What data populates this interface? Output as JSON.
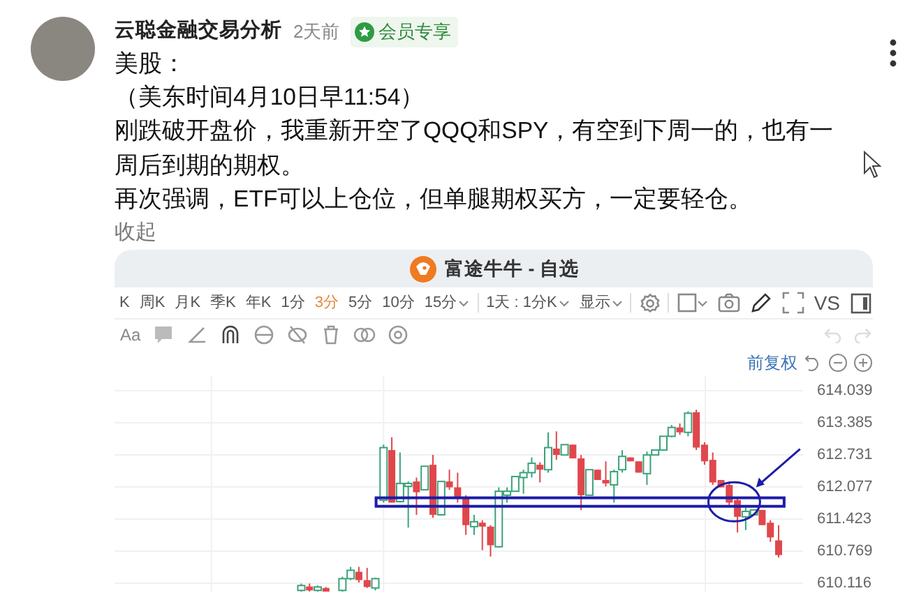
{
  "post": {
    "author": "云聪金融交易分析",
    "time": "2天前",
    "badge": "会员专享",
    "paragraphs": [
      "美股：",
      "（美东时间4月10日早11:54）",
      "刚跌破开盘价，我重新开空了QQQ和SPY，有空到下周一的，也有一周后到期的期权。",
      "再次强调，ETF可以上仓位，但单腿期权买方，一定要轻仓。"
    ],
    "collapse_link": "收起"
  },
  "embedded_window": {
    "title": "富途牛牛 - 自选",
    "toolbar_items": [
      {
        "label": "K",
        "kind": "tab",
        "selected": false
      },
      {
        "label": "周K",
        "kind": "tab",
        "selected": false
      },
      {
        "label": "月K",
        "kind": "tab",
        "selected": false
      },
      {
        "label": "季K",
        "kind": "tab",
        "selected": false
      },
      {
        "label": "年K",
        "kind": "tab",
        "selected": false
      },
      {
        "label": "1分",
        "kind": "tab",
        "selected": false
      },
      {
        "label": "3分",
        "kind": "tab",
        "selected": true
      },
      {
        "label": "5分",
        "kind": "tab",
        "selected": false
      },
      {
        "label": "10分",
        "kind": "tab",
        "selected": false
      },
      {
        "label": "15分",
        "kind": "dropdown",
        "selected": false
      },
      {
        "label": "1天 : 1分K",
        "kind": "dropdown",
        "selected": false
      },
      {
        "label": "显示",
        "kind": "dropdown",
        "selected": false
      }
    ],
    "compare_label": "VS",
    "font_tool_label": "Aa",
    "adjustment_link": "前复权",
    "chart_data": {
      "type": "candlestick",
      "grid": true,
      "ylim": [
        609.946,
        614.352
      ],
      "yticks": [
        {
          "value": 614.039,
          "label": "614.039"
        },
        {
          "value": 613.385,
          "label": "613.385"
        },
        {
          "value": 612.731,
          "label": "612.731"
        },
        {
          "value": 612.077,
          "label": "612.077"
        },
        {
          "value": 611.423,
          "label": "611.423"
        },
        {
          "value": 610.769,
          "label": "610.769"
        },
        {
          "value": 610.116,
          "label": "610.116"
        }
      ],
      "categories": [
        null,
        null,
        null,
        null,
        null,
        null,
        null,
        null,
        null,
        null,
        null,
        null,
        null,
        null,
        null,
        null,
        null,
        null,
        null,
        null,
        null,
        null,
        null,
        null,
        null,
        null,
        null,
        null,
        null,
        null,
        null,
        null,
        null,
        null,
        null,
        null,
        null,
        null,
        null,
        null,
        null,
        null,
        null,
        null,
        null,
        null,
        null,
        null,
        null,
        null,
        null,
        null,
        null,
        null,
        null,
        null,
        null,
        null,
        null
      ],
      "ohlc": [
        [
          609.97,
          610.11,
          609.94,
          610.07
        ],
        [
          610.05,
          610.11,
          609.94,
          609.97
        ],
        [
          609.97,
          610.07,
          609.94,
          610.04
        ],
        [
          610.02,
          610.04,
          609.92,
          609.94
        ],
        null,
        [
          609.97,
          610.25,
          609.94,
          610.21
        ],
        [
          610.21,
          610.45,
          610.18,
          610.38
        ],
        [
          610.35,
          610.45,
          610.13,
          610.18
        ],
        [
          610.18,
          610.43,
          610.02,
          610.04
        ],
        [
          610.02,
          610.23,
          609.97,
          610.21
        ],
        [
          611.81,
          612.94,
          611.76,
          612.88
        ],
        [
          612.83,
          613.09,
          611.76,
          611.76
        ],
        [
          611.78,
          612.78,
          611.76,
          612.15
        ],
        [
          612.09,
          612.19,
          611.25,
          612.15
        ],
        [
          612.19,
          612.27,
          611.51,
          611.97
        ],
        [
          612.02,
          612.5,
          612.02,
          612.5
        ],
        [
          612.53,
          612.73,
          611.45,
          611.51
        ],
        [
          611.51,
          612.19,
          611.51,
          612.19
        ],
        [
          612.19,
          612.43,
          612.02,
          612.07
        ],
        [
          612.07,
          612.37,
          611.76,
          611.86
        ],
        [
          611.86,
          611.91,
          611.1,
          611.3
        ],
        [
          611.27,
          611.51,
          611.1,
          611.37
        ],
        [
          611.35,
          611.4,
          610.79,
          611.27
        ],
        [
          611.27,
          611.3,
          610.66,
          610.89
        ],
        [
          610.86,
          612.07,
          610.84,
          611.99
        ],
        [
          611.91,
          612.07,
          611.76,
          611.99
        ],
        [
          611.99,
          612.29,
          611.99,
          612.29
        ],
        [
          612.27,
          612.43,
          611.94,
          612.37
        ],
        [
          612.37,
          612.68,
          612.27,
          612.56
        ],
        [
          612.53,
          612.58,
          612.17,
          612.43
        ],
        [
          612.43,
          613.19,
          612.37,
          612.88
        ],
        [
          612.86,
          613.21,
          612.63,
          612.73
        ],
        [
          612.73,
          612.94,
          612.73,
          612.94
        ],
        [
          612.94,
          612.94,
          612.66,
          612.66
        ],
        [
          612.66,
          612.73,
          611.61,
          611.91
        ],
        [
          611.91,
          612.43,
          611.91,
          612.43
        ],
        [
          612.43,
          612.43,
          612.22,
          612.22
        ],
        [
          612.22,
          612.6,
          612.09,
          612.15
        ],
        [
          612.12,
          612.43,
          611.76,
          612.39
        ],
        [
          612.43,
          612.83,
          612.37,
          612.7
        ],
        [
          612.68,
          612.68,
          612.6,
          612.6
        ],
        [
          612.6,
          612.6,
          612.37,
          612.37
        ],
        [
          612.35,
          612.8,
          612.12,
          612.73
        ],
        [
          612.73,
          612.83,
          612.73,
          612.83
        ],
        [
          612.83,
          613.11,
          612.83,
          613.11
        ],
        [
          613.11,
          613.34,
          613.09,
          613.29
        ],
        [
          613.29,
          613.37,
          613.14,
          613.19
        ],
        [
          613.19,
          613.62,
          613.11,
          613.58
        ],
        [
          613.6,
          613.65,
          612.83,
          612.88
        ],
        [
          612.94,
          612.99,
          612.53,
          612.6
        ],
        [
          612.63,
          612.78,
          612.12,
          612.17
        ],
        [
          612.22,
          612.22,
          612.07,
          612.07
        ],
        [
          612.12,
          612.17,
          611.71,
          611.76
        ],
        [
          611.81,
          611.86,
          611.15,
          611.47
        ],
        [
          611.47,
          611.66,
          611.2,
          611.58
        ],
        [
          611.51,
          611.61,
          611.51,
          611.61
        ],
        [
          611.61,
          611.61,
          611.3,
          611.3
        ],
        [
          611.35,
          611.4,
          610.96,
          611.05
        ],
        [
          610.99,
          611.3,
          610.64,
          610.69
        ]
      ]
    }
  }
}
